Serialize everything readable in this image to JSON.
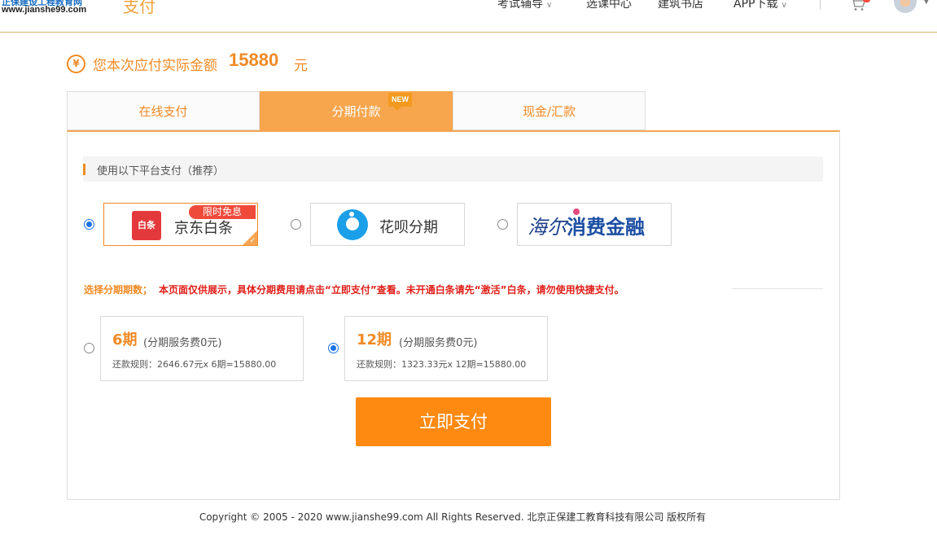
{
  "header": {
    "logo_top": "正保建设工程教育网",
    "logo_url": "www.jianshe99.com",
    "page_title": "支付",
    "nav": [
      {
        "label": "考试辅导",
        "dropdown": true
      },
      {
        "label": "选课中心",
        "dropdown": false
      },
      {
        "label": "建筑书店",
        "dropdown": false
      },
      {
        "label": "APP下载",
        "dropdown": true
      }
    ]
  },
  "amount": {
    "label": "您本次应付实际金额",
    "value": "15880",
    "unit": "元"
  },
  "tabs": [
    {
      "label": "在线支付",
      "active": false
    },
    {
      "label": "分期付款",
      "active": true,
      "badge": "NEW"
    },
    {
      "label": "现金/汇款",
      "active": false
    }
  ],
  "platform_section": {
    "title": "使用以下平台支付（推荐）"
  },
  "platforms": [
    {
      "logo_text": "白条",
      "name": "京东白条",
      "promo": "限时免息",
      "selected": true
    },
    {
      "name": "花呗分期",
      "selected": false
    },
    {
      "brand_hand": "海尔",
      "brand_text": "消费金融",
      "selected": false
    }
  ],
  "installment_notice": {
    "label": "选择分期期数；",
    "message": "本页面仅供展示，具体分期费用请点击“立即支付”查看。未开通白条请先“激活”白条，请勿使用快捷支付。"
  },
  "periods": [
    {
      "num": "6期",
      "fee": "(分期服务费0元)",
      "rule": "还款规则：2646.67元x 6期=15880.00",
      "selected": false
    },
    {
      "num": "12期",
      "fee": "(分期服务费0元)",
      "rule": "还款规则：1323.33元x 12期=15880.00",
      "selected": true
    }
  ],
  "pay_button": "立即支付",
  "footer": "Copyright © 2005 - 2020 www.jianshe99.com All Rights Reserved.   北京正保建工教育科技有限公司 版权所有",
  "colors": {
    "accent": "#f08a24",
    "tab_active": "#f7a64d",
    "button": "#ff8a12",
    "warning": "#e0201a",
    "radio": "#1a73e8"
  }
}
